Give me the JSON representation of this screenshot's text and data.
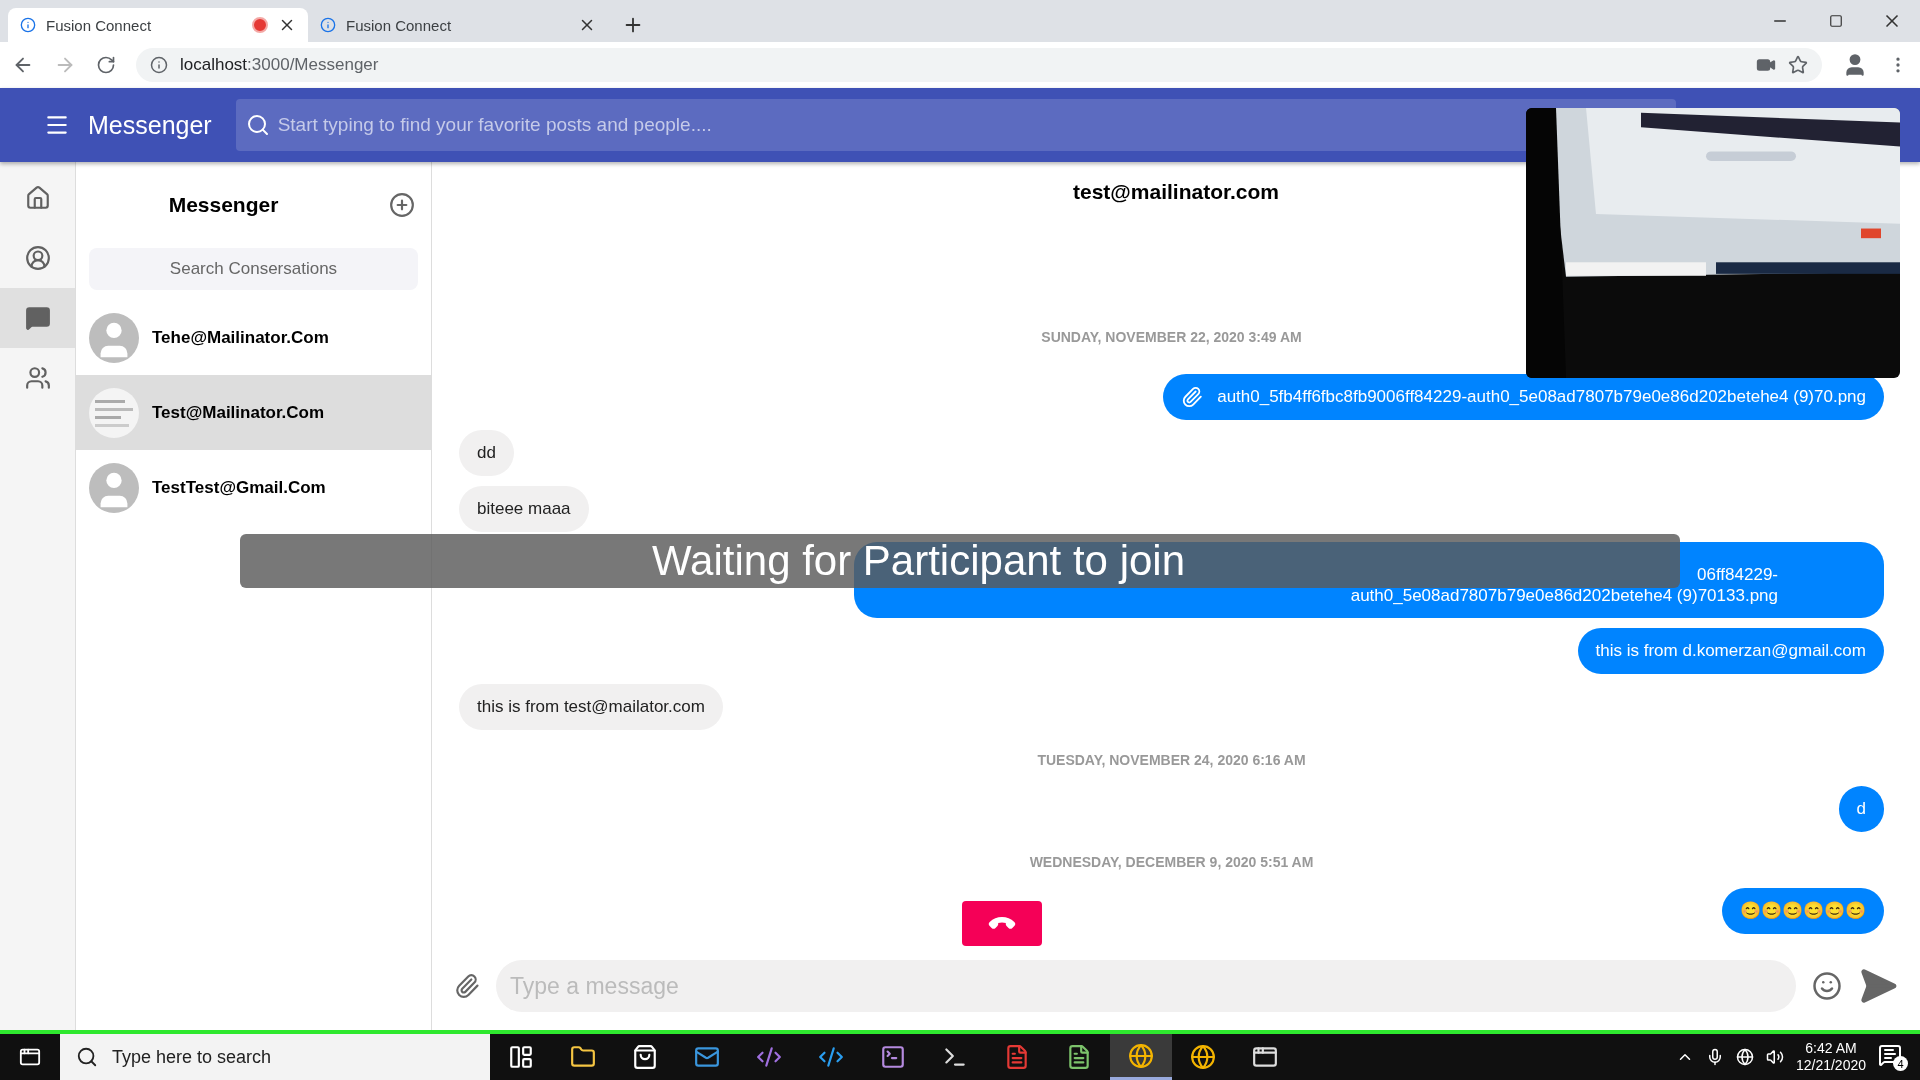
{
  "browser": {
    "tabs": [
      {
        "title": "Fusion Connect",
        "selected": true,
        "recording": true
      },
      {
        "title": "Fusion Connect",
        "selected": false,
        "recording": false
      }
    ],
    "url_host": "localhost",
    "url_path": ":3000/Messenger"
  },
  "app_bar": {
    "title": "Messenger",
    "search": {
      "placeholder": "Start typing to find your favorite posts and people...."
    }
  },
  "rail": [
    {
      "kind": "home",
      "selected": false
    },
    {
      "kind": "profile",
      "selected": false
    },
    {
      "kind": "chat",
      "selected": true
    },
    {
      "kind": "people",
      "selected": false
    }
  ],
  "conversations": {
    "title": "Messenger",
    "search": {
      "placeholder": "Search Consersations"
    },
    "items": [
      {
        "name": "Tehe@Mailinator.Com",
        "kind": "default",
        "selected": false
      },
      {
        "name": "Test@Mailinator.Com",
        "kind": "picture",
        "selected": true
      },
      {
        "name": "TestTest@Gmail.Com",
        "kind": "default",
        "selected": false
      }
    ]
  },
  "chat": {
    "title": "test@mailinator.com",
    "messages": [
      {
        "kind": "date",
        "text": "SUNDAY, NOVEMBER 22, 2020 3:49 AM"
      },
      {
        "kind": "sent",
        "attachment": true,
        "text": "auth0_5fb4ff6fbc8fb9006ff84229-auth0_5e08ad7807b79e0e86d202betehe4 (9)70.png"
      },
      {
        "kind": "received",
        "attachment": false,
        "text": "dd"
      },
      {
        "kind": "received",
        "attachment": false,
        "text": "biteee maaa"
      },
      {
        "kind": "sent",
        "attachment": false,
        "covered": true,
        "text": "06ff84229-\nauth0_5e08ad7807b79e0e86d202betehe4 (9)70133.png"
      },
      {
        "kind": "sent",
        "attachment": false,
        "text": "this is from d.komerzan@gmail.com"
      },
      {
        "kind": "received",
        "attachment": false,
        "text": "this is from test@mailator.com"
      },
      {
        "kind": "date",
        "text": "TUESDAY, NOVEMBER 24, 2020 6:16 AM"
      },
      {
        "kind": "sent",
        "attachment": false,
        "text": "d"
      },
      {
        "kind": "date",
        "text": "WEDNESDAY, DECEMBER 9, 2020 5:51 AM"
      },
      {
        "kind": "sent",
        "attachment": false,
        "text": "😊😊😊😊😊😊"
      }
    ],
    "composer": {
      "placeholder": "Type a message"
    },
    "overlay": {
      "text": "Waiting for Participant to join"
    }
  },
  "taskbar": {
    "search": {
      "placeholder": "Type here to search"
    },
    "apps": [
      {
        "kind": "taskview",
        "selected": false
      },
      {
        "kind": "folder",
        "selected": false
      },
      {
        "kind": "store",
        "selected": false
      },
      {
        "kind": "mail",
        "selected": false
      },
      {
        "kind": "vs",
        "selected": false
      },
      {
        "kind": "vscode",
        "selected": false
      },
      {
        "kind": "terminal",
        "selected": false
      },
      {
        "kind": "console",
        "selected": false
      },
      {
        "kind": "ftp",
        "selected": false
      },
      {
        "kind": "notepad",
        "selected": false
      },
      {
        "kind": "chrome",
        "selected": true
      },
      {
        "kind": "chrome",
        "selected": false
      },
      {
        "kind": "window",
        "selected": false
      }
    ],
    "time": "6:42 AM",
    "date": "12/21/2020",
    "notifications": "4"
  }
}
